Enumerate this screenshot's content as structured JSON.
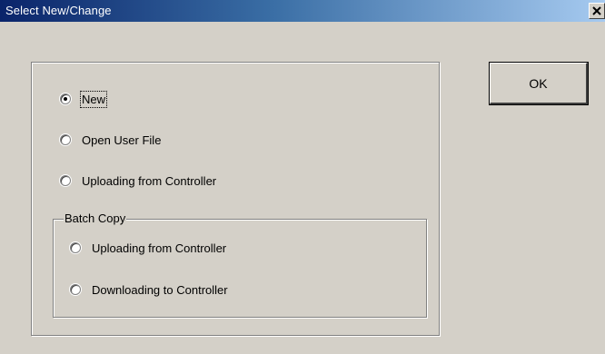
{
  "window": {
    "title": "Select New/Change"
  },
  "options": [
    {
      "label": "New",
      "checked": true
    },
    {
      "label": "Open User File",
      "checked": false
    },
    {
      "label": "Uploading from Controller",
      "checked": false
    }
  ],
  "batch_copy": {
    "legend": "Batch Copy",
    "options": [
      {
        "label": "Uploading from Controller",
        "checked": false
      },
      {
        "label": "Downloading to Controller",
        "checked": false
      }
    ]
  },
  "buttons": {
    "ok_label": "OK"
  }
}
